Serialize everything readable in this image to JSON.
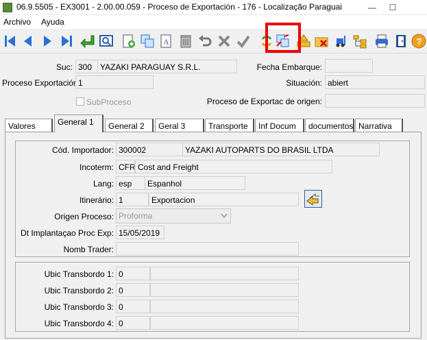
{
  "window": {
    "title": "06.9.5505 - EX3001 - 2.00.00.059 - Proceso de Exportación - 176 - Localização Paraguai",
    "minimize": "—",
    "maximize": "☐"
  },
  "menu": {
    "items": [
      "Archivo",
      "Ayuda"
    ]
  },
  "toolbar": {
    "buttons": [
      "first-icon",
      "prev-icon",
      "next-icon",
      "last-icon",
      "enter-icon",
      "view-icon",
      "new-icon",
      "copy-icon",
      "edit-text-icon",
      "delete-icon",
      "undo-icon",
      "cancel-icon",
      "confirm-icon",
      "refresh-icon",
      "duplicate-icon",
      "insert-icon",
      "folder-delete-icon",
      "forklift-icon",
      "tree-icon",
      "print-icon",
      "exit-icon",
      "help-icon"
    ],
    "highlight_color": "#e00000"
  },
  "header": {
    "suc_label": "Suc:",
    "suc_code": "300",
    "suc_name": "YAZAKI PARAGUAY S.R.L.",
    "fecha_label": "Fecha Embarque:",
    "fecha_value": "",
    "proceso_label": "Proceso Exportación:",
    "proceso_value": "1",
    "situacion_label": "Situación:",
    "situacion_value": "abiert",
    "subproceso_label": "SubProceso",
    "origen_label": "Proceso de Exportac de origen:",
    "origen_value": ""
  },
  "tabs": [
    "Valores",
    "General 1",
    "General 2",
    "Geral 3",
    "Transporte",
    "Inf Docum",
    "documentos",
    "Narrativa"
  ],
  "active_tab": "General 1",
  "general": {
    "importador_label": "Cód. Importador:",
    "importador_code": "300002",
    "importador_name": "YAZAKI AUTOPARTS DO BRASIL LTDA",
    "incoterm_label": "Incoterm:",
    "incoterm_code": "CFR",
    "incoterm_name": "Cost and Freight",
    "lang_label": "Lang:",
    "lang_code": "esp",
    "lang_name": "Espanhol",
    "itinerario_label": "Itinerário:",
    "itinerario_code": "1",
    "itinerario_name": "Exportacion",
    "origen_proceso_label": "Origen Proceso:",
    "origen_proceso_value": "Proforma",
    "dt_label": "Dt Implantaçao Proc Exp:",
    "dt_value": "15/05/2019",
    "nomb_trader_label": "Nomb Trader:",
    "nomb_trader_value": ""
  },
  "transbordo": [
    {
      "label": "Ubic Transbordo 1:",
      "code": "0",
      "name": ""
    },
    {
      "label": "Ubic Transbordo 2:",
      "code": "0",
      "name": ""
    },
    {
      "label": "Ubic Transbordo 3:",
      "code": "0",
      "name": ""
    },
    {
      "label": "Ubic Transbordo 4:",
      "code": "0",
      "name": ""
    }
  ]
}
